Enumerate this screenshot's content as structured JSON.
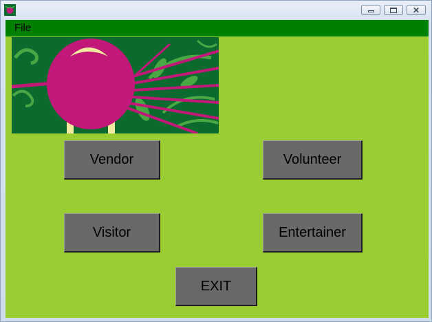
{
  "window": {
    "icon": "beet-icon",
    "controls": [
      "minimize-icon",
      "maximize-icon",
      "close-icon"
    ]
  },
  "menu": {
    "file_label": "File"
  },
  "banner": {
    "image": "beet-illustration"
  },
  "buttons": {
    "vendor": "Vendor",
    "volunteer": "Volunteer",
    "visitor": "Visitor",
    "entertainer": "Entertainer",
    "exit": "EXIT"
  },
  "colors": {
    "background": "#9acd32",
    "menubar": "#008000",
    "button": "#696969",
    "beet": "#c2187a",
    "banner_bg": "#0b6b2e"
  }
}
